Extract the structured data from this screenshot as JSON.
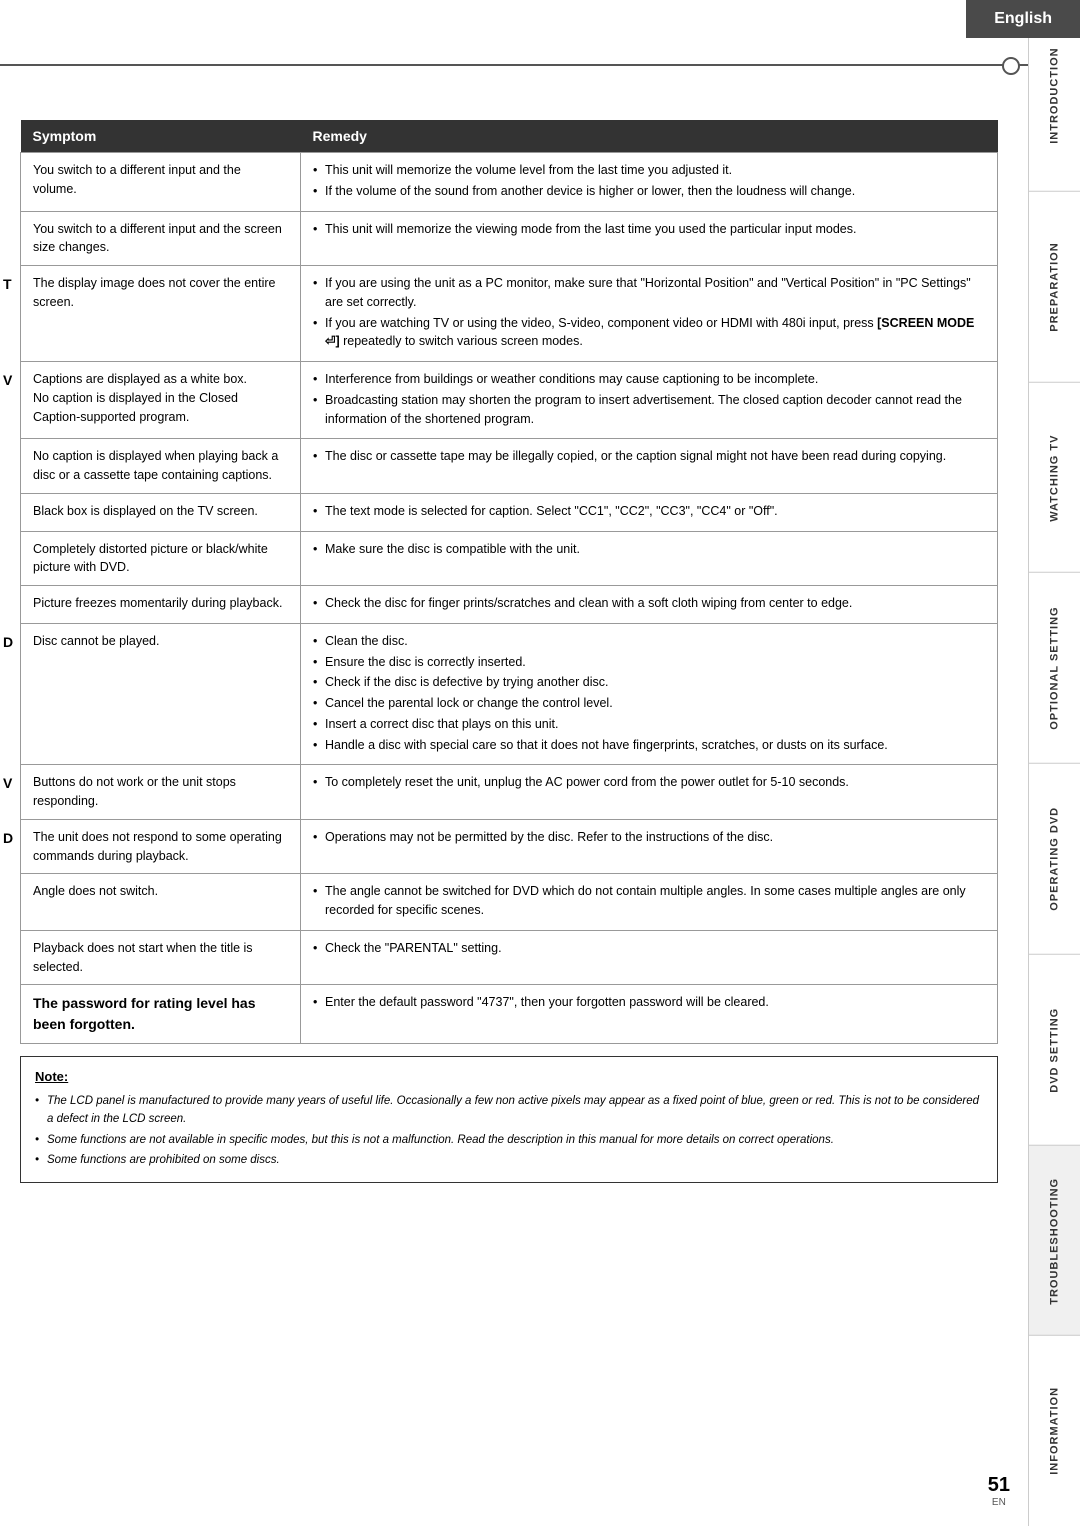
{
  "header": {
    "language": "English"
  },
  "right_nav": {
    "items": [
      {
        "label": "INTRODUCTION"
      },
      {
        "label": "PREPARATION"
      },
      {
        "label": "WATCHING TV"
      },
      {
        "label": "OPTIONAL SETTING"
      },
      {
        "label": "OPERATING DVD"
      },
      {
        "label": "DVD SETTING"
      },
      {
        "label": "TROUBLESHOOTING",
        "active": true
      },
      {
        "label": "INFORMATION"
      }
    ]
  },
  "table": {
    "headers": [
      "Symptom",
      "Remedy"
    ],
    "rows": [
      {
        "left_label": "",
        "symptom": "You switch to a different input and the volume.",
        "remedy": "• This unit will memorize the volume level from the last time you adjusted it.\n• If the volume of the sound from another device is higher or lower, then the loudness will change."
      },
      {
        "left_label": "",
        "symptom": "You switch to a different input and the screen size changes.",
        "remedy": "• This unit will memorize the viewing mode from the last time you used the particular input modes."
      },
      {
        "left_label": "T",
        "symptom": "The display image does not cover the entire screen.",
        "remedy": "• If you are using the unit as a PC monitor, make sure that \"Horizontal Position\" and \"Vertical Position\" in \"PC Settings\" are set correctly.\n• If you are watching TV or using the video, S-video, component video or HDMI with 480i input, press [SCREEN MODE ⏎] repeatedly to switch various screen modes."
      },
      {
        "left_label": "V",
        "symptom": "Captions are displayed as a white box.\nNo caption is displayed in the Closed Caption-supported program.",
        "remedy": "• Interference from buildings or weather conditions may cause captioning to be incomplete.\n• Broadcasting station may shorten the program to insert advertisement. The closed caption decoder cannot read the information of the shortened program."
      },
      {
        "left_label": "",
        "symptom": "No caption is displayed when playing back a disc or a cassette tape containing captions.",
        "remedy": "• The disc or cassette tape may be illegally copied, or the caption signal might not have been read during copying."
      },
      {
        "left_label": "",
        "symptom": "Black box is displayed on the TV screen.",
        "remedy": "• The text mode is selected for caption. Select \"CC1\", \"CC2\", \"CC3\", \"CC4\" or \"Off\"."
      },
      {
        "left_label": "",
        "symptom": "Completely distorted picture or black/white picture with DVD.",
        "remedy": "• Make sure the disc is compatible with the unit."
      },
      {
        "left_label": "",
        "symptom": "Picture freezes momentarily during playback.",
        "remedy": "• Check the disc for finger prints/scratches and clean with a soft cloth wiping from center to edge."
      },
      {
        "left_label": "D",
        "symptom": "Disc cannot be played.",
        "remedy": "• Clean the disc.\n• Ensure the disc is correctly inserted.\n• Check if the disc is defective by trying another disc.\n• Cancel the parental lock or change the control level.\n• Insert a correct disc that plays on this unit.\n• Handle a disc with special care so that it does not have fingerprints, scratches, or dusts on its surface."
      },
      {
        "left_label": "V",
        "symptom": "Buttons do not work or the unit stops responding.",
        "remedy": "• To completely reset the unit, unplug the AC power cord from the power outlet for 5-10 seconds."
      },
      {
        "left_label": "D",
        "symptom": "The unit does not respond to some operating commands during playback.",
        "remedy": "• Operations may not be permitted by the disc. Refer to the instructions of the disc."
      },
      {
        "left_label": "",
        "symptom": "Angle does not switch.",
        "remedy": "• The angle cannot be switched for DVD which do not contain multiple angles. In some cases multiple angles are only recorded for specific scenes."
      },
      {
        "left_label": "",
        "symptom": "Playback does not start when the title is selected.",
        "remedy": "• Check the \"PARENTAL\" setting."
      },
      {
        "left_label": "",
        "symptom": "The password for rating level has been forgotten.",
        "symptom_bold": true,
        "remedy": "• Enter the default password \"4737\", then your forgotten password will be cleared."
      }
    ]
  },
  "note": {
    "title": "Note:",
    "items": [
      "The LCD panel is manufactured to provide many years of useful life. Occasionally a few non active pixels may appear as a fixed point of blue, green or red. This is not to be considered a defect in the LCD screen.",
      "Some functions are not available in specific modes, but this is not a malfunction. Read the description in this manual for more details on correct operations.",
      "Some functions are prohibited on some discs."
    ]
  },
  "page": {
    "number": "51",
    "sub": "EN"
  }
}
